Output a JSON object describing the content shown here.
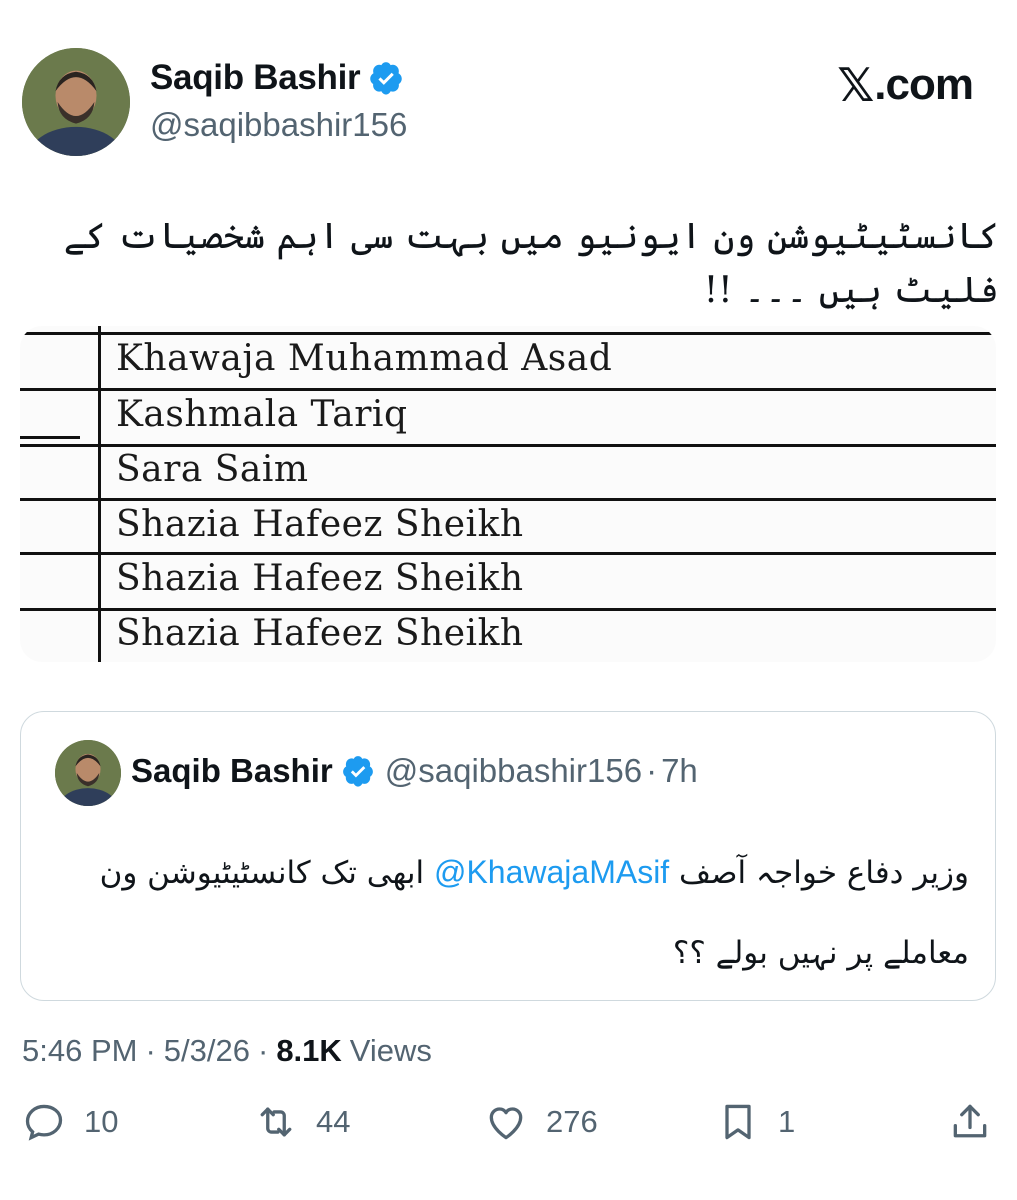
{
  "author": {
    "name": "Saqib Bashir",
    "handle": "@saqibbashir156"
  },
  "brand": {
    "logo_glyph": "𝕏",
    "logo_suffix": ".com"
  },
  "tweet": {
    "text": "کانسٹیٹیوشن ون ایونیو میں بہت سی اہم شخصیات کے فلیٹ ہیں ۔۔۔ !!"
  },
  "document_image": {
    "rows": [
      "Khawaja Muhammad Asad",
      "Kashmala Tariq",
      "Sara Saim",
      "Shazia Hafeez Sheikh",
      "Shazia Hafeez Sheikh",
      "Shazia Hafeez Sheikh"
    ]
  },
  "quoted": {
    "name": "Saqib Bashir",
    "handle": "@saqibbashir156",
    "separator": "·",
    "time": "7h",
    "text_before": "وزیر دفاع خواجہ آصف",
    "mention": "@KhawajaMAsif",
    "text_after": "ابھی تک کانسٹیٹیوشن ون معاملے پر نہیں بولے ؟؟"
  },
  "meta": {
    "time": "5:46 PM",
    "sep1": "·",
    "date": "5/3/26",
    "sep2": "·",
    "views_count": "8.1K",
    "views_label": "Views"
  },
  "actions": {
    "replies": "10",
    "reposts": "44",
    "likes": "276",
    "bookmarks": "1"
  },
  "colors": {
    "text": "#0f1419",
    "secondary": "#536471",
    "accent": "#1d9bf0",
    "border": "#cfd9de"
  },
  "icons": [
    "verified-badge-icon",
    "reply-icon",
    "repost-icon",
    "like-icon",
    "bookmark-icon",
    "share-icon"
  ]
}
